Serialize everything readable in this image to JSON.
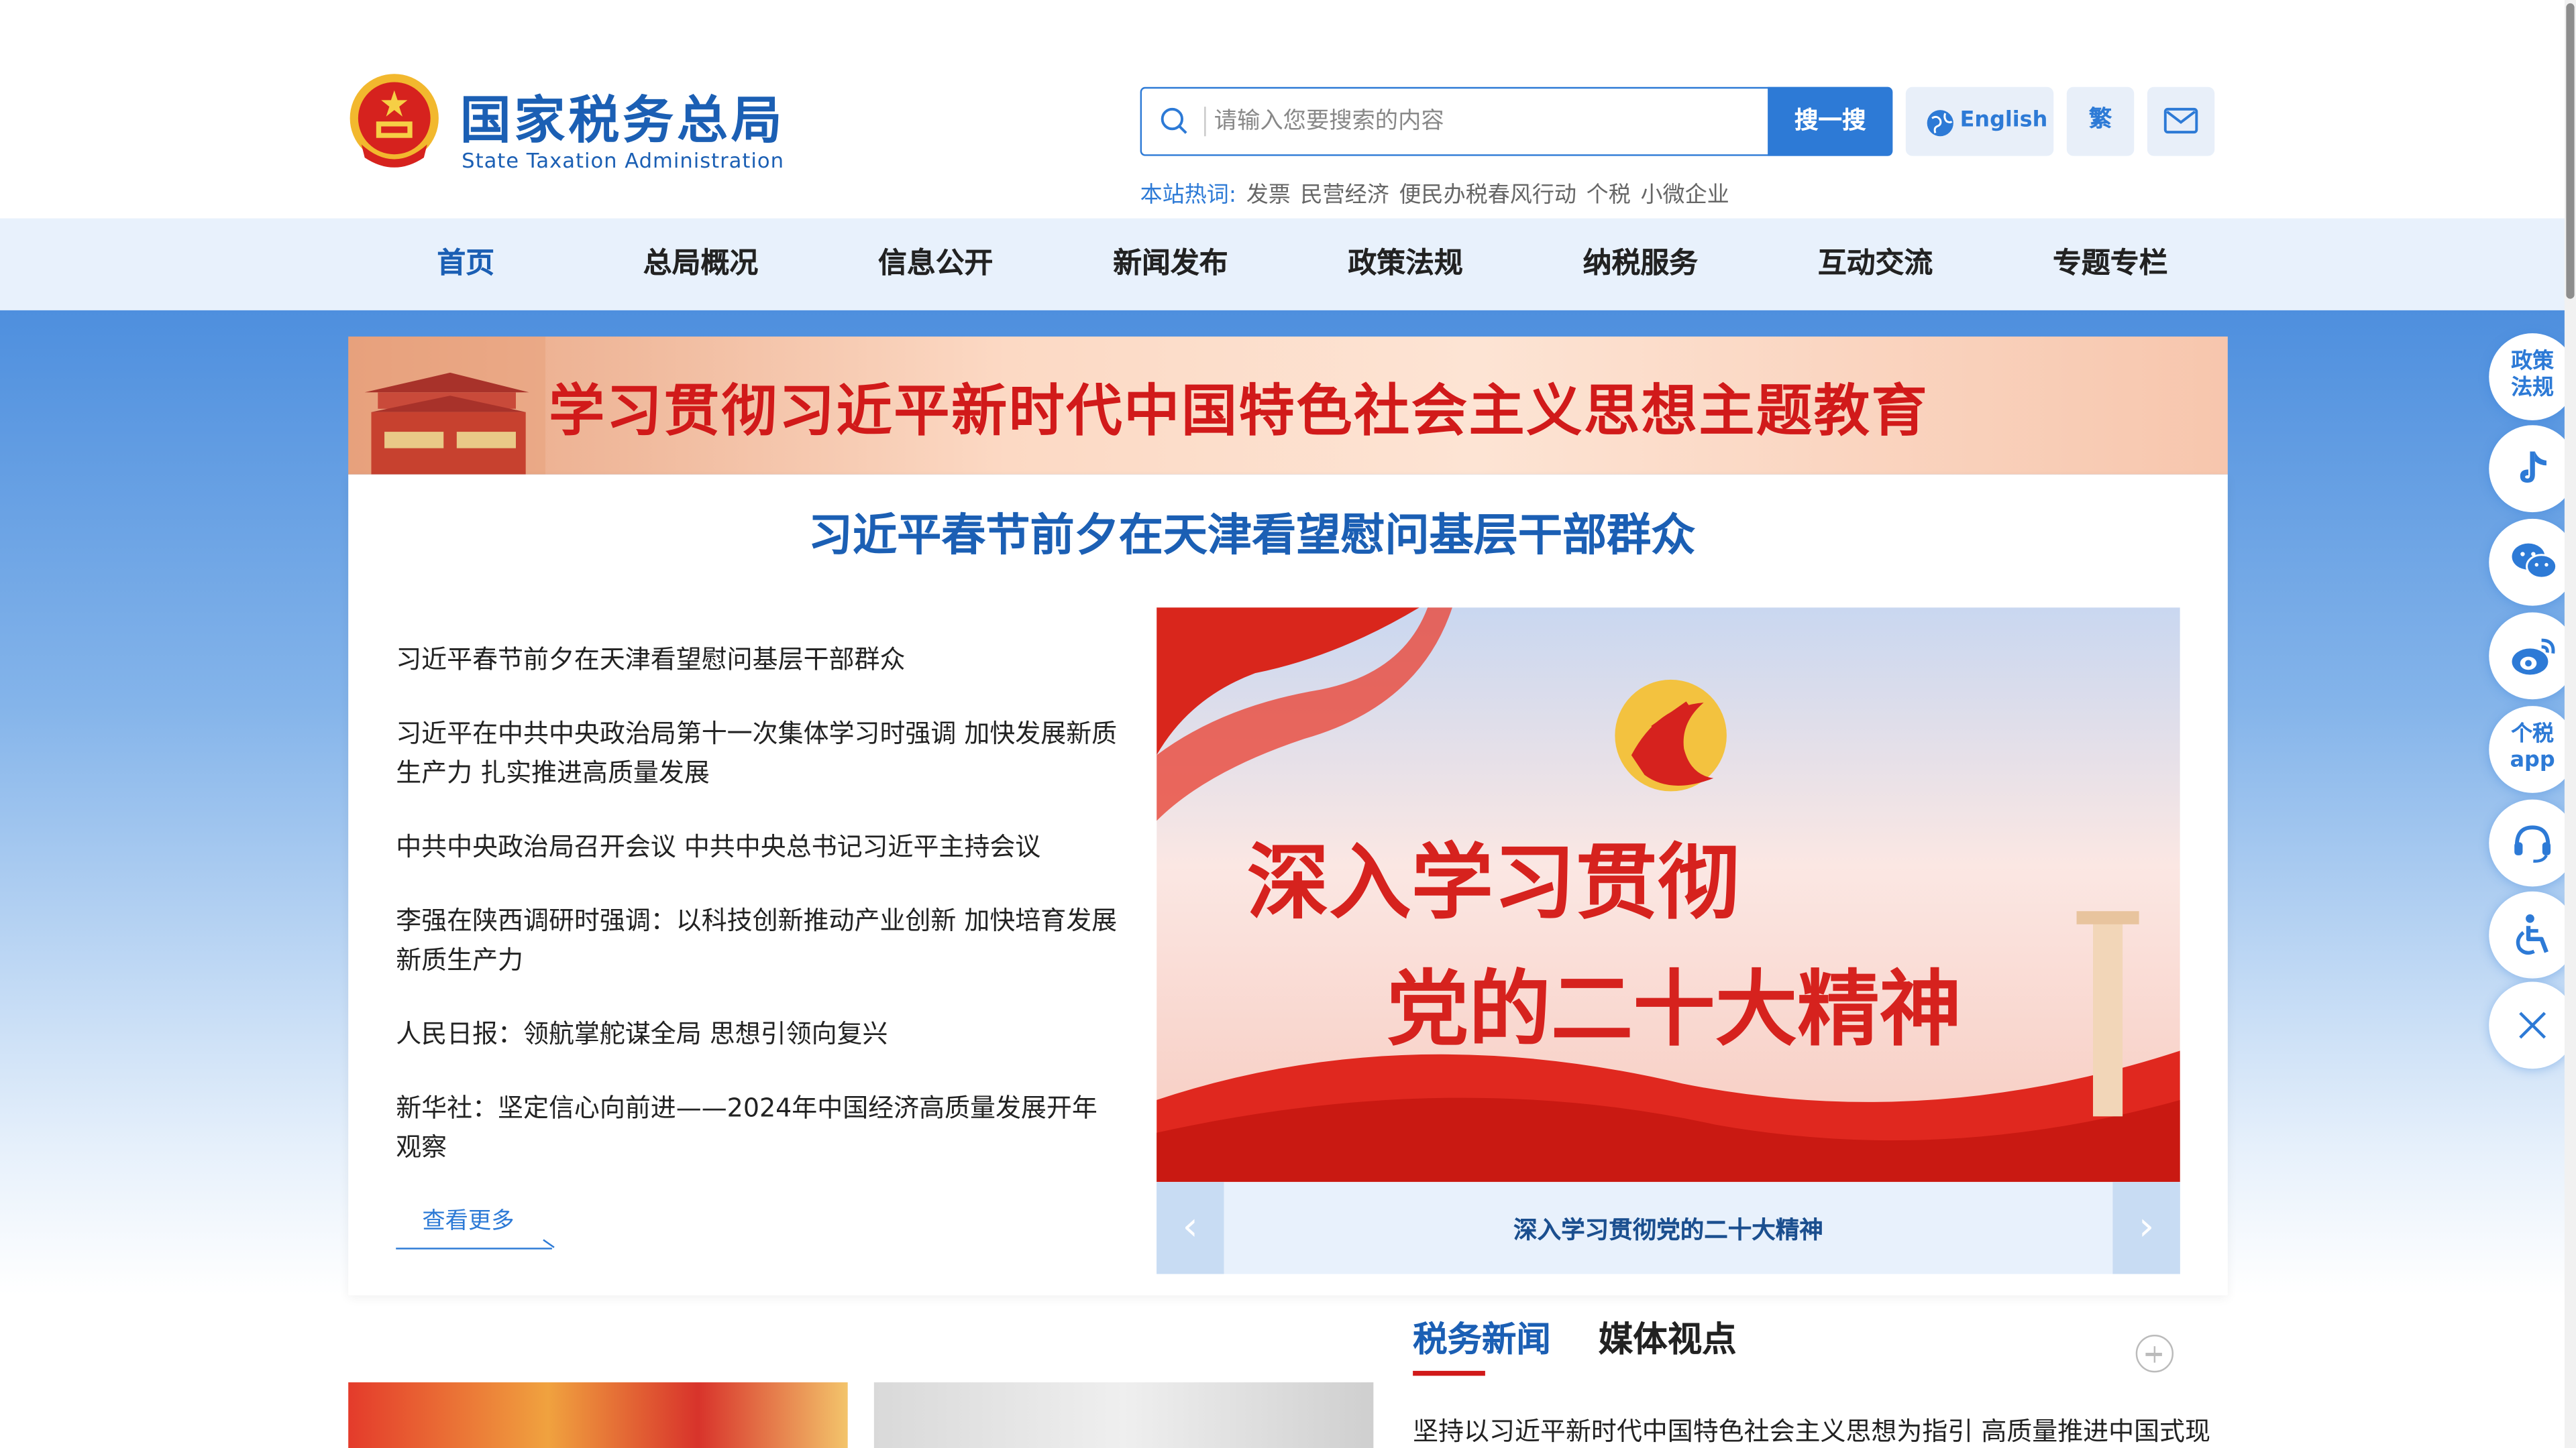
{
  "header": {
    "logo_cn": "国家税务总局",
    "logo_en": "State Taxation Administration",
    "search_placeholder": "请输入您要搜索的内容",
    "search_button": "搜一搜",
    "english_button": "English",
    "traditional_button": "繁"
  },
  "hot_words": {
    "label": "本站热词:",
    "items": [
      "发票",
      "民营经济",
      "便民办税春风行动",
      "个税",
      "小微企业"
    ]
  },
  "nav": {
    "items": [
      "首页",
      "总局概况",
      "信息公开",
      "新闻发布",
      "政策法规",
      "纳税服务",
      "互动交流",
      "专题专栏"
    ],
    "active": "首页"
  },
  "banner": {
    "text": "学习贯彻习近平新时代中国特色社会主义思想主题教育"
  },
  "main": {
    "headline": "习近平春节前夕在天津看望慰问基层干部群众",
    "news": [
      "习近平春节前夕在天津看望慰问基层干部群众",
      "习近平在中共中央政治局第十一次集体学习时强调 加快发展新质生产力 扎实推进高质量发展",
      "中共中央政治局召开会议 中共中央总书记习近平主持会议",
      "李强在陕西调研时强调：以科技创新推动产业创新 加快培育发展新质生产力",
      "人民日报：领航掌舵谋全局 思想引领向复兴",
      "新华社：坚定信心向前进——2024年中国经济高质量发展开年观察"
    ],
    "more": "查看更多"
  },
  "slide": {
    "line1": "深入学习贯彻",
    "line2": "党的二十大精神",
    "caption": "深入学习贯彻党的二十大精神",
    "prev": "‹",
    "next": "›"
  },
  "lower": {
    "tab_tax": "税务新闻",
    "tab_media": "媒体视点",
    "first_item": "坚持以习近平新时代中国特色社会主义思想为指引 高质量推进中国式现"
  },
  "float": {
    "policy": [
      "政策",
      "法规"
    ],
    "app": [
      "个税",
      "app"
    ]
  },
  "colors": {
    "brand_blue": "#1b5fb4",
    "accent_blue": "#2d7ad6",
    "red": "#d11a1a"
  }
}
